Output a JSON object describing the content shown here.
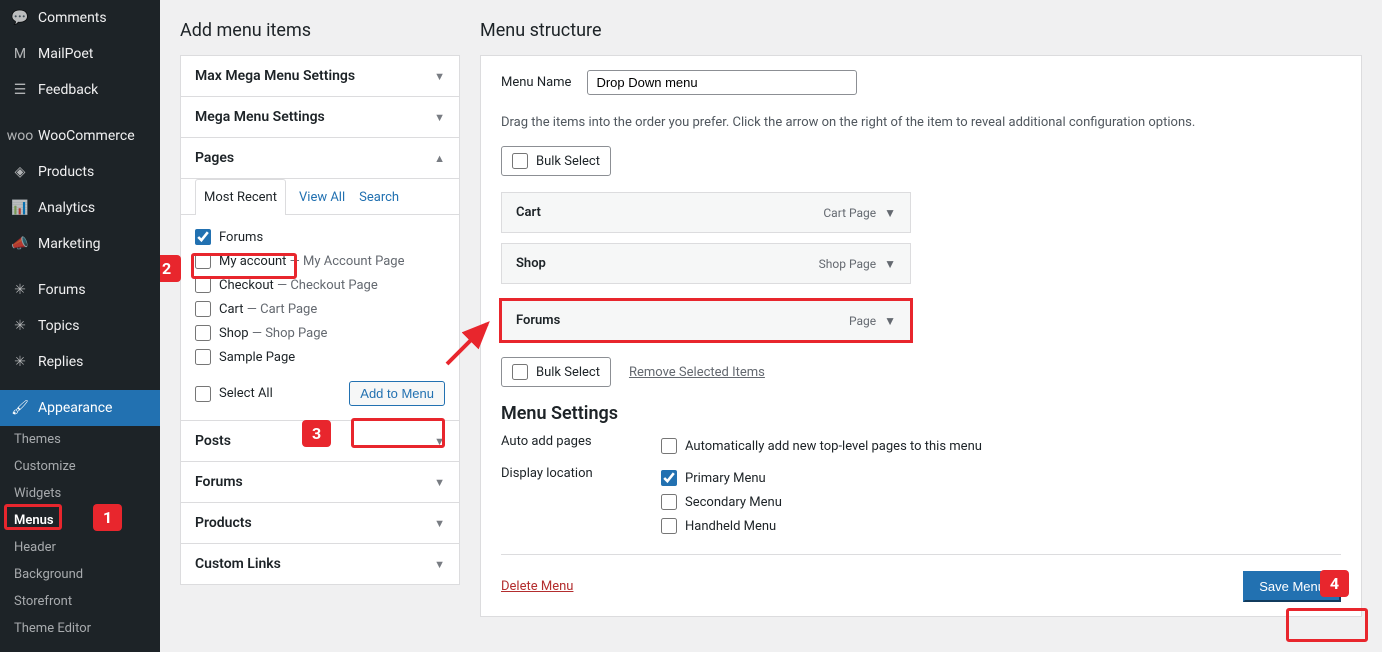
{
  "sidebar": {
    "items": [
      {
        "id": "comments",
        "label": "Comments"
      },
      {
        "id": "mailpoet",
        "label": "MailPoet"
      },
      {
        "id": "feedback",
        "label": "Feedback"
      },
      {
        "id": "woocommerce",
        "label": "WooCommerce"
      },
      {
        "id": "products",
        "label": "Products"
      },
      {
        "id": "analytics",
        "label": "Analytics"
      },
      {
        "id": "marketing",
        "label": "Marketing"
      },
      {
        "id": "forums",
        "label": "Forums"
      },
      {
        "id": "topics",
        "label": "Topics"
      },
      {
        "id": "replies",
        "label": "Replies"
      },
      {
        "id": "appearance",
        "label": "Appearance",
        "active": true
      }
    ],
    "subs": [
      {
        "id": "themes",
        "label": "Themes"
      },
      {
        "id": "customize",
        "label": "Customize"
      },
      {
        "id": "widgets",
        "label": "Widgets"
      },
      {
        "id": "menus",
        "label": "Menus",
        "active": true
      },
      {
        "id": "header",
        "label": "Header"
      },
      {
        "id": "background",
        "label": "Background"
      },
      {
        "id": "storefront",
        "label": "Storefront"
      },
      {
        "id": "theme-editor",
        "label": "Theme Editor"
      }
    ]
  },
  "left": {
    "heading": "Add menu items",
    "panels": {
      "maxmega": "Max Mega Menu Settings",
      "mega": "Mega Menu Settings",
      "pages": "Pages",
      "posts": "Posts",
      "forums": "Forums",
      "products": "Products",
      "custom": "Custom Links"
    },
    "tabs": {
      "recent": "Most Recent",
      "all": "View All",
      "search": "Search"
    },
    "pages_list": [
      {
        "label": "Forums",
        "sub": "",
        "checked": true
      },
      {
        "label": "My account",
        "sub": " — My Account Page",
        "checked": false
      },
      {
        "label": "Checkout",
        "sub": " — Checkout Page",
        "checked": false
      },
      {
        "label": "Cart",
        "sub": " — Cart Page",
        "checked": false
      },
      {
        "label": "Shop",
        "sub": " — Shop Page",
        "checked": false
      },
      {
        "label": "Sample Page",
        "sub": "",
        "checked": false
      }
    ],
    "select_all": "Select All",
    "add_button": "Add to Menu"
  },
  "right": {
    "heading": "Menu structure",
    "name_label": "Menu Name",
    "name_value": "Drop Down menu",
    "instructions": "Drag the items into the order you prefer. Click the arrow on the right of the item to reveal additional configuration options.",
    "bulk": "Bulk Select",
    "remove": "Remove Selected Items",
    "items": [
      {
        "title": "Cart",
        "type": "Cart Page"
      },
      {
        "title": "Shop",
        "type": "Shop Page"
      },
      {
        "title": "Forums",
        "type": "Page",
        "highlight": true
      }
    ],
    "settings_heading": "Menu Settings",
    "auto_label": "Auto add pages",
    "auto_check": "Automatically add new top-level pages to this menu",
    "display_label": "Display location",
    "locations": [
      {
        "label": "Primary Menu",
        "checked": true
      },
      {
        "label": "Secondary Menu",
        "checked": false
      },
      {
        "label": "Handheld Menu",
        "checked": false
      }
    ],
    "delete": "Delete Menu",
    "save": "Save Menu"
  },
  "annotations": {
    "1": "1",
    "2": "2",
    "3": "3",
    "4": "4"
  }
}
